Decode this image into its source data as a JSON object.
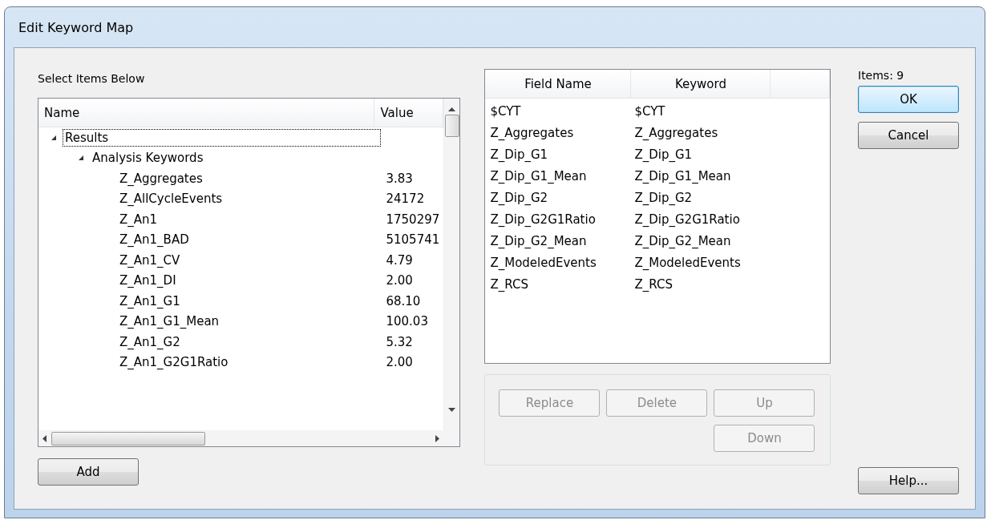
{
  "window": {
    "title": "Edit Keyword Map"
  },
  "select_label": "Select Items Below",
  "tree": {
    "columns": [
      "Name",
      "Value"
    ],
    "items": [
      {
        "name": "Results",
        "expanded": true,
        "selected": true,
        "children": [
          {
            "name": "Analysis Keywords",
            "expanded": true,
            "selected": false,
            "children": [
              {
                "name": "Z_Aggregates",
                "value": "3.83",
                "selected": false
              },
              {
                "name": "Z_AllCycleEvents",
                "value": "24172",
                "selected": false
              },
              {
                "name": "Z_An1",
                "value": "1750297",
                "selected": false
              },
              {
                "name": "Z_An1_BAD",
                "value": "5105741",
                "selected": false
              },
              {
                "name": "Z_An1_CV",
                "value": "4.79",
                "selected": false
              },
              {
                "name": "Z_An1_DI",
                "value": "2.00",
                "selected": false
              },
              {
                "name": "Z_An1_G1",
                "value": "68.10",
                "selected": false
              },
              {
                "name": "Z_An1_G1_Mean",
                "value": "100.03",
                "selected": false
              },
              {
                "name": "Z_An1_G2",
                "value": "5.32",
                "selected": false
              },
              {
                "name": "Z_An1_G2G1Ratio",
                "value": "2.00",
                "selected": false
              }
            ]
          }
        ]
      }
    ]
  },
  "add_button": {
    "label": "Add",
    "disabled": false
  },
  "mapping": {
    "columns": [
      "Field Name",
      "Keyword"
    ],
    "rows": [
      [
        "$CYT",
        "$CYT"
      ],
      [
        "Z_Aggregates",
        "Z_Aggregates"
      ],
      [
        "Z_Dip_G1",
        "Z_Dip_G1"
      ],
      [
        "Z_Dip_G1_Mean",
        "Z_Dip_G1_Mean"
      ],
      [
        "Z_Dip_G2",
        "Z_Dip_G2"
      ],
      [
        "Z_Dip_G2G1Ratio",
        "Z_Dip_G2G1Ratio"
      ],
      [
        "Z_Dip_G2_Mean",
        "Z_Dip_G2_Mean"
      ],
      [
        "Z_ModeledEvents",
        "Z_ModeledEvents"
      ],
      [
        "Z_RCS",
        "Z_RCS"
      ]
    ]
  },
  "edit_buttons": [
    {
      "label": "Replace",
      "disabled": true
    },
    {
      "label": "Delete",
      "disabled": true
    },
    {
      "label": "Up",
      "disabled": true
    },
    {
      "label": "Down",
      "disabled": true
    }
  ],
  "items_count": "Items: 9",
  "dialog_buttons": [
    {
      "label": "OK",
      "default": true
    },
    {
      "label": "Cancel",
      "default": false
    }
  ],
  "help_button": {
    "label": "Help..."
  }
}
